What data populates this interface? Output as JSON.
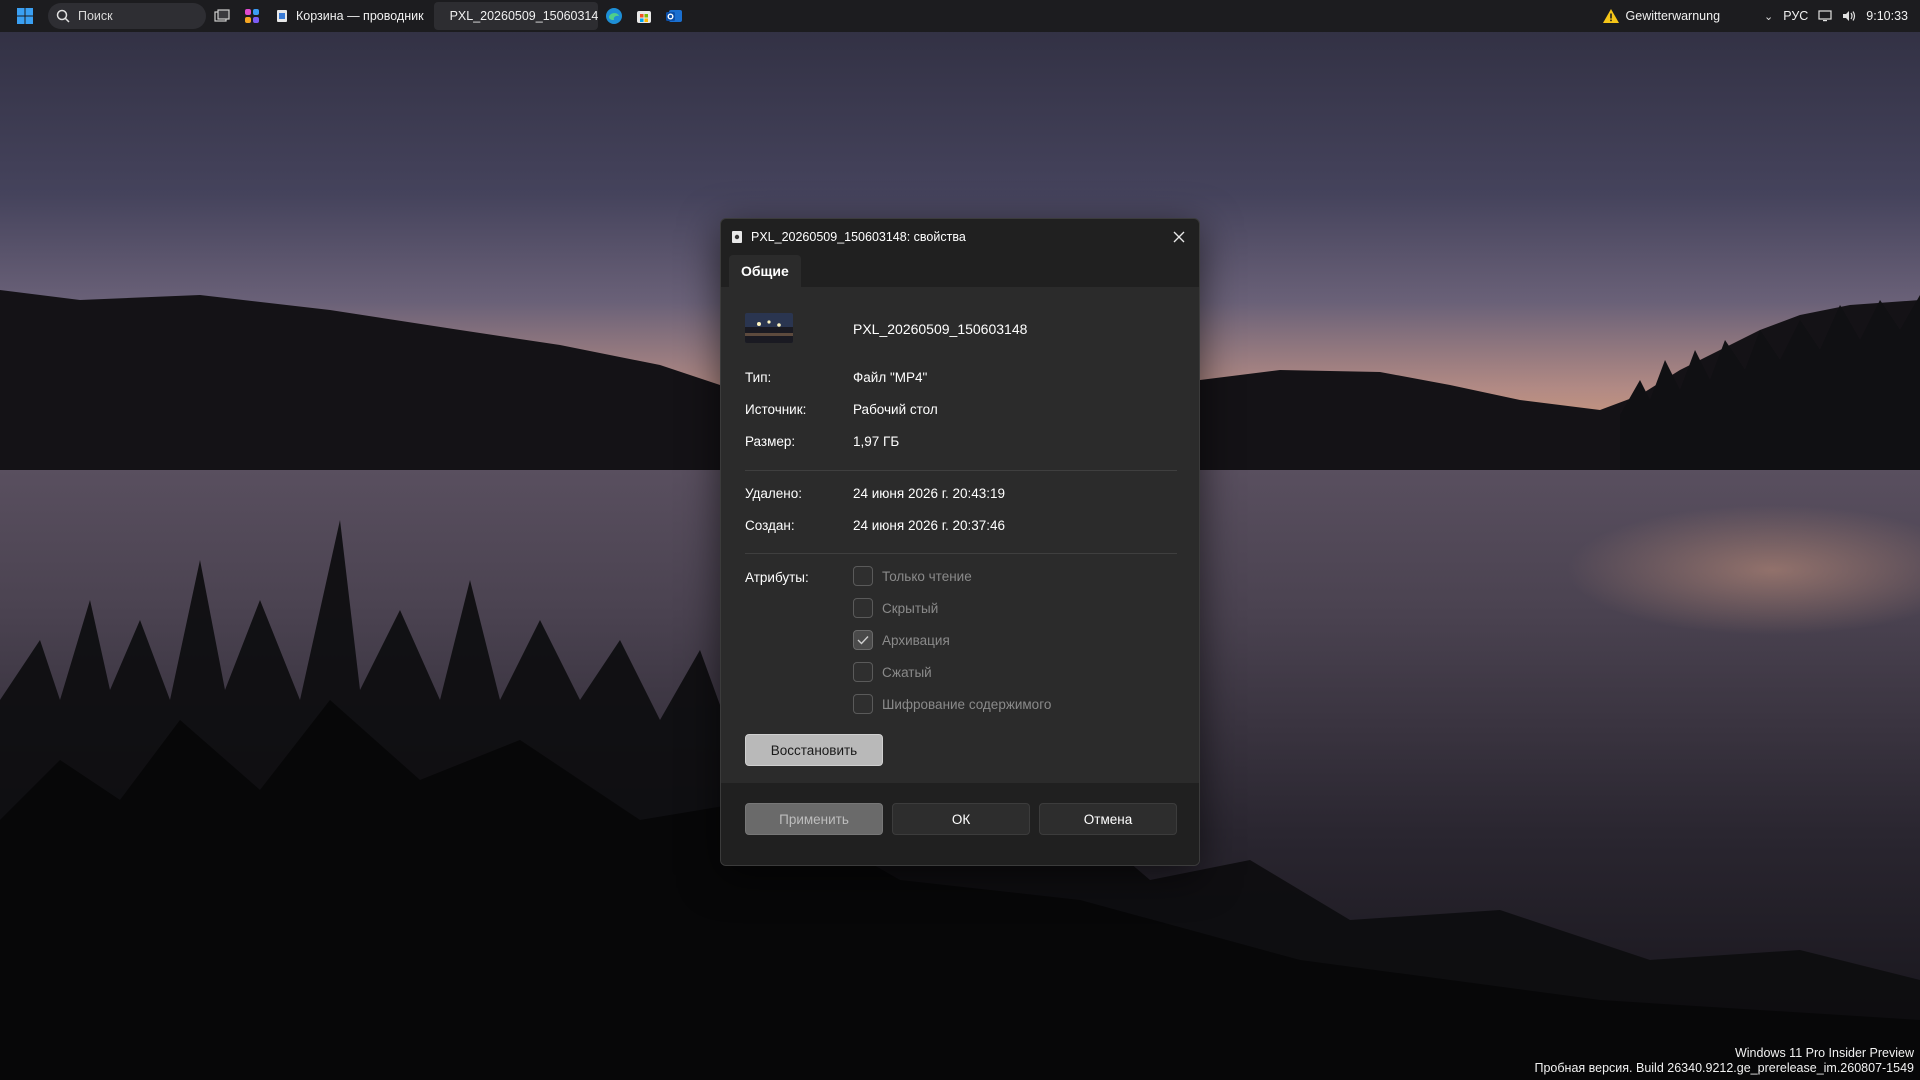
{
  "taskbar": {
    "search_placeholder": "Поиск",
    "apps": [
      {
        "label": "Корзина — проводник",
        "active": false
      },
      {
        "label": "PXL_20260509_15060314",
        "active": true
      }
    ],
    "weather_text": "Gewitterwarnung",
    "language": "РУС",
    "clock": "9:10:33"
  },
  "dialog": {
    "title": "PXL_20260509_150603148: свойства",
    "tab_general": "Общие",
    "filename": "PXL_20260509_150603148",
    "type_label": "Тип:",
    "type_value": "Файл \"MP4\"",
    "source_label": "Источник:",
    "source_value": "Рабочий стол",
    "size_label": "Размер:",
    "size_value": "1,97 ГБ",
    "deleted_label": "Удалено:",
    "deleted_value": "24 июня 2026 г. 20:43:19",
    "created_label": "Создан:",
    "created_value": "24 июня 2026 г. 20:37:46",
    "attributes_label": "Атрибуты:",
    "attributes": [
      {
        "label": "Только чтение",
        "checked": false
      },
      {
        "label": "Скрытый",
        "checked": false
      },
      {
        "label": "Архивация",
        "checked": true
      },
      {
        "label": "Сжатый",
        "checked": false
      },
      {
        "label": "Шифрование содержимого",
        "checked": false
      }
    ],
    "restore_button": "Восстановить",
    "apply_button": "Применить",
    "ok_button": "ОК",
    "cancel_button": "Отмена"
  },
  "watermark": {
    "line1": "Windows 11 Pro Insider Preview",
    "line2": "Пробная версия. Build 26340.9212.ge_prerelease_im.260807-1549"
  },
  "colors": {
    "taskbar_bg": "#1c1c1f",
    "dialog_bg": "#202020",
    "content_bg": "#2b2b2b",
    "accent_blue": "#0078d4",
    "warning_yellow": "#f5c518"
  }
}
